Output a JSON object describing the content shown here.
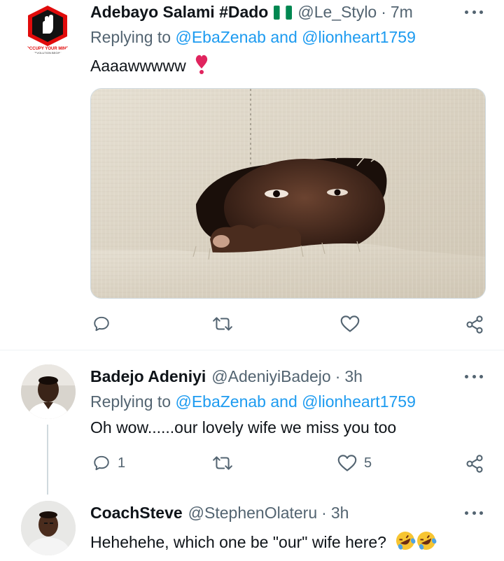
{
  "tweets": [
    {
      "name": "Adebayo Salami #Dado",
      "flag": "🇳🇬",
      "handle": "@Le_Stylo",
      "time": "7m",
      "replying_prefix": "Replying to",
      "mention1": "@EbaZenab",
      "and": "and",
      "mention2": "@lionheart1759",
      "text": "Aaaawwwww",
      "emoji": "❣️",
      "avatar_text_top": "OCCUPY YOUR MIND",
      "avatar_text_bottom": "REVOLUTION BEGINS",
      "replies": "",
      "retweets": "",
      "likes": ""
    },
    {
      "name": "Badejo Adeniyi",
      "handle": "@AdeniyiBadejo",
      "time": "3h",
      "replying_prefix": "Replying to",
      "mention1": "@EbaZenab",
      "and": "and",
      "mention2": "@lionheart1759",
      "text": "Oh wow......our lovely wife we miss you too",
      "replies": "1",
      "retweets": "",
      "likes": "5"
    },
    {
      "name": "CoachSteve",
      "handle": "@StephenOlateru",
      "time": "3h",
      "text": "Hehehehe, which one be \"our\" wife here?",
      "emoji": "🤣🤣"
    }
  ],
  "separator": "·",
  "icons": [
    "reply-icon",
    "retweet-icon",
    "like-icon",
    "share-icon",
    "more-icon"
  ],
  "colors": {
    "link": "#1d9bf0",
    "secondary": "#536471",
    "primary": "#0f1419",
    "heart": "#e0245e"
  }
}
